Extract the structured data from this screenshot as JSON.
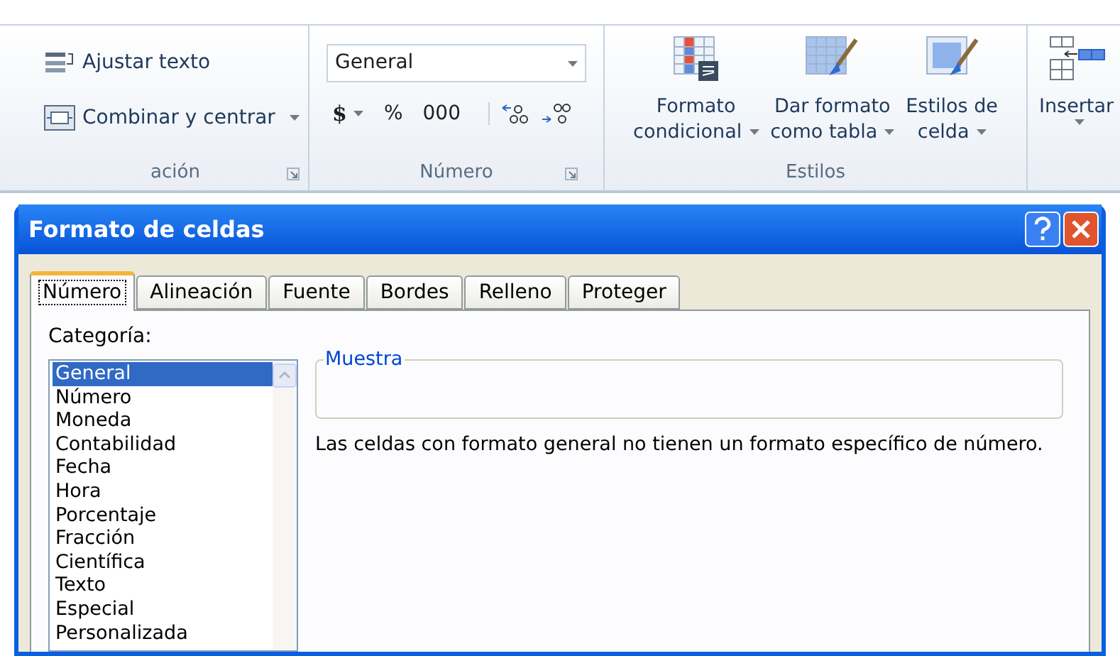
{
  "ribbon": {
    "alignment_group": {
      "label": "ación",
      "buttons": [
        {
          "label": "Ajustar texto",
          "dropdown": false
        },
        {
          "label": "Combinar y centrar",
          "dropdown": true
        }
      ]
    },
    "number_group": {
      "label": "Número",
      "format_select": {
        "value": "General"
      },
      "buttons": [
        {
          "label": "$",
          "dropdown": true
        },
        {
          "label": "%",
          "dropdown": false
        },
        {
          "label": "000",
          "dropdown": false
        }
      ]
    },
    "styles_group": {
      "label": "Estilos",
      "buttons": [
        {
          "kind": "conditional",
          "lines": [
            "Formato",
            "condicional"
          ]
        },
        {
          "kind": "table",
          "lines": [
            "Dar formato",
            "como tabla"
          ]
        },
        {
          "kind": "cell",
          "lines": [
            "Estilos de",
            "celda"
          ]
        }
      ]
    },
    "insert_button": {
      "label": "Insertar"
    }
  },
  "dialog": {
    "title": "Formato de celdas",
    "tabs": [
      {
        "label": "Número",
        "selected": true
      },
      {
        "label": "Alineación",
        "selected": false
      },
      {
        "label": "Fuente",
        "selected": false
      },
      {
        "label": "Bordes",
        "selected": false
      },
      {
        "label": "Relleno",
        "selected": false
      },
      {
        "label": "Proteger",
        "selected": false
      }
    ],
    "category_label": "Categoría:",
    "categories": [
      {
        "label": "General",
        "selected": true
      },
      {
        "label": "Número",
        "selected": false
      },
      {
        "label": "Moneda",
        "selected": false
      },
      {
        "label": "Contabilidad",
        "selected": false
      },
      {
        "label": "Fecha",
        "selected": false
      },
      {
        "label": "Hora",
        "selected": false
      },
      {
        "label": "Porcentaje",
        "selected": false
      },
      {
        "label": "Fracción",
        "selected": false
      },
      {
        "label": "Científica",
        "selected": false
      },
      {
        "label": "Texto",
        "selected": false
      },
      {
        "label": "Especial",
        "selected": false
      },
      {
        "label": "Personalizada",
        "selected": false
      }
    ],
    "sample_label": "Muestra",
    "description": "Las celdas con formato general no tienen un formato específico de número."
  }
}
